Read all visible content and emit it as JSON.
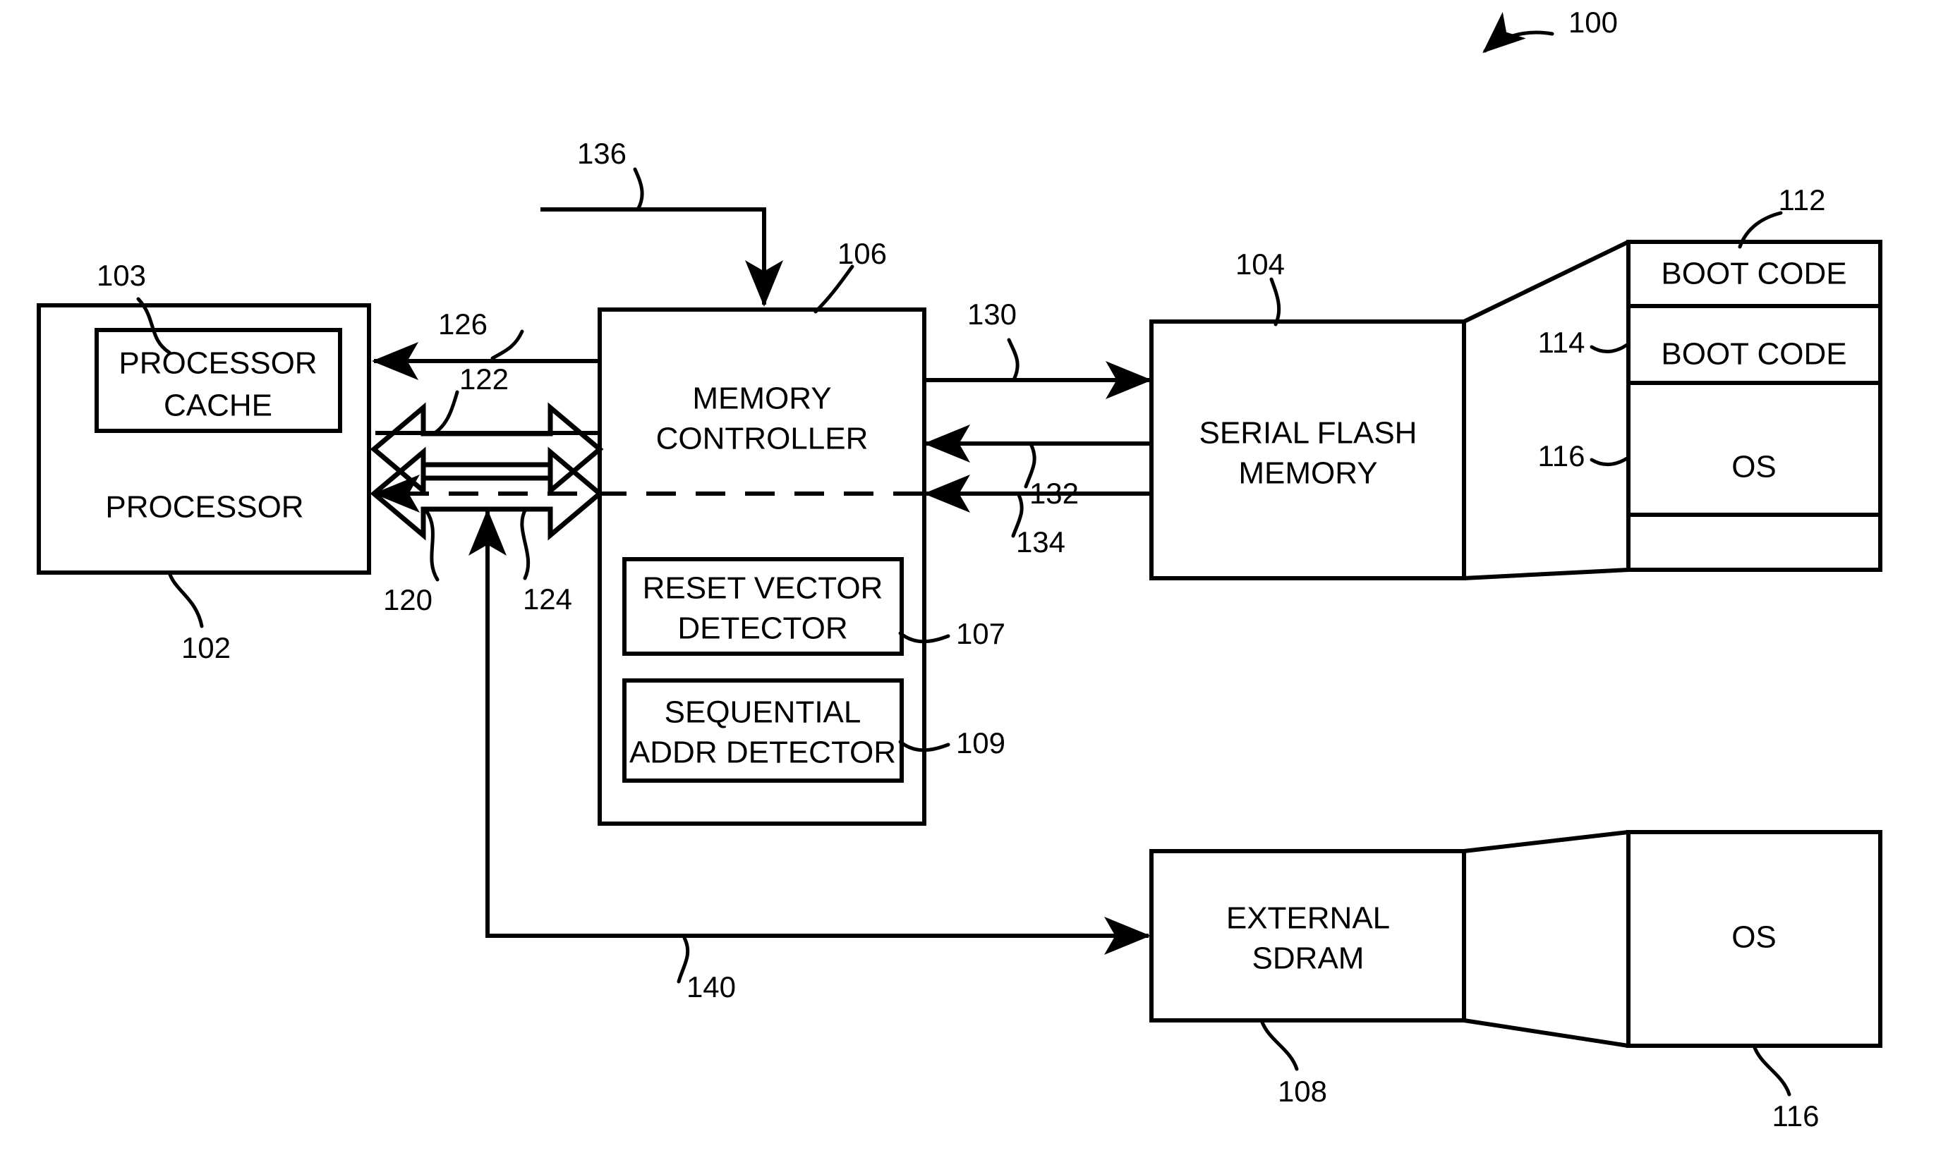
{
  "figure": {
    "title": "Boot code / memory controller block diagram",
    "figure_ref": "100"
  },
  "blocks": {
    "processor": {
      "label": "PROCESSOR",
      "ref": "102"
    },
    "processor_cache": {
      "label": "PROCESSOR\nCACHE",
      "line1": "PROCESSOR",
      "line2": "CACHE",
      "ref": "103"
    },
    "memory_controller": {
      "line1": "MEMORY",
      "line2": "CONTROLLER",
      "ref": "106"
    },
    "reset_vector_detector": {
      "line1": "RESET VECTOR",
      "line2": "DETECTOR",
      "ref": "107"
    },
    "sequential_addr_detector": {
      "line1": "SEQUENTIAL",
      "line2": "ADDR DETECTOR",
      "ref": "109"
    },
    "serial_flash_memory": {
      "line1": "SERIAL FLASH",
      "line2": "MEMORY",
      "ref": "104"
    },
    "external_sdram": {
      "line1": "EXTERNAL",
      "line2": "SDRAM",
      "ref": "108"
    },
    "os_sdram_detail": {
      "label": "OS",
      "ref": "116"
    }
  },
  "flash_map": {
    "ref": "112",
    "rows": [
      {
        "label": "BOOT CODE",
        "ref": "112"
      },
      {
        "label": "BOOT CODE",
        "ref": "114"
      },
      {
        "label": "OS",
        "ref": "116"
      },
      {
        "label": "",
        "ref": ""
      }
    ]
  },
  "connectors": [
    {
      "ref": "120",
      "description": "processor-to-memory-controller bus lower"
    },
    {
      "ref": "122",
      "description": "processor-to-memory-controller bus upper"
    },
    {
      "ref": "124",
      "description": "memory-controller-to-processor bus"
    },
    {
      "ref": "126",
      "description": "memory controller to processor arrow"
    },
    {
      "ref": "130",
      "description": "memory controller to serial flash"
    },
    {
      "ref": "132",
      "description": "serial flash to memory controller"
    },
    {
      "ref": "134",
      "description": "serial flash to memory controller dashed path"
    },
    {
      "ref": "136",
      "description": "external input into memory controller"
    },
    {
      "ref": "140",
      "description": "bus to external SDRAM"
    }
  ],
  "ref_numbers": {
    "n100": "100",
    "n102": "102",
    "n103": "103",
    "n104": "104",
    "n106": "106",
    "n107": "107",
    "n108": "108",
    "n109": "109",
    "n112": "112",
    "n114": "114",
    "n116_flash": "116",
    "n116_sdram": "116",
    "n120": "120",
    "n122": "122",
    "n124": "124",
    "n126": "126",
    "n130": "130",
    "n132": "132",
    "n134": "134",
    "n136": "136",
    "n140": "140"
  },
  "colors": {
    "stroke": "#000000",
    "background": "#ffffff"
  }
}
